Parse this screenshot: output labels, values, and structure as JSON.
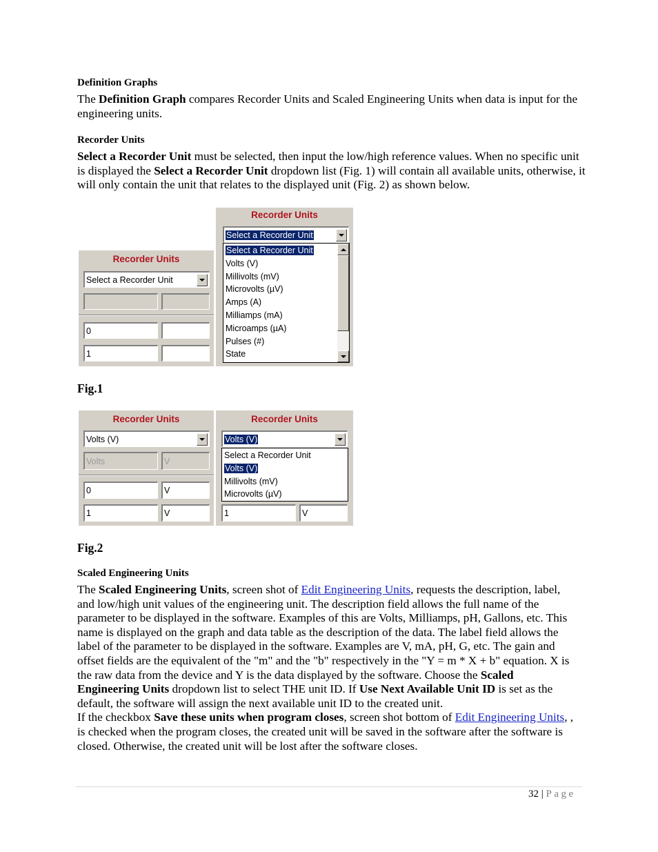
{
  "sections": {
    "definition_graphs": {
      "heading": "Definition Graphs",
      "para_intro": "The ",
      "para_bold": "Definition Graph",
      "para_rest": " compares Recorder Units and Scaled Engineering Units when data is input for the engineering units."
    },
    "recorder_units": {
      "heading": "Recorder Units",
      "p1_bold": "Select a Recorder Unit",
      "p1_text": " must be selected, then input the low/high reference values. When no specific unit is displayed the ",
      "p1_bold2": "Select a Recorder Unit",
      "p1_text2": " dropdown list (Fig. 1) will contain all available units, otherwise, it will only contain the unit that relates to the displayed unit (Fig. 2) as shown below."
    },
    "scaled_units": {
      "heading": "Scaled Engineering Units",
      "t1": "The ",
      "b1": "Scaled Engineering Units",
      "t2": ", screen shot of ",
      "link1": "Edit Engineering Units",
      "t3": ", requests the description, label, and low/high unit values of the engineering unit. The description field allows the full name of the parameter to be displayed in the software. Examples of this are Volts, Milliamps, pH, Gallons, etc. This name is displayed on the graph and data table as the description of the data. The label field allows the label of the parameter to be displayed in the software. Examples are V, mA, pH, G, etc. The gain and offset fields are the equivalent of the \"m\" and the \"b\" respectively in the \"Y = m * X + b\" equation. X is the raw data from the device and Y is the data displayed by the software. Choose the ",
      "b2": "Scaled Engineering Units",
      "t4": " dropdown list to select THE unit ID. If ",
      "b3": "Use Next Available Unit ID",
      "t5": " is set as the default, the software will assign the next available unit ID to the created unit.",
      "t6": "If the checkbox ",
      "b4": "Save these units when program closes",
      "t7": ", screen shot bottom of ",
      "link2": "Edit Engineering Units",
      "t8": ", , is checked when the program closes, the created unit will be saved in the software after the software is closed. Otherwise, the created unit will be lost after the software closes."
    }
  },
  "fig1": {
    "label": "Fig.1",
    "left_panel": {
      "title": "Recorder Units",
      "combo_value": "Select a Recorder Unit",
      "desc_value": "",
      "label_value": "",
      "low_value": "0",
      "low_unit": "",
      "high_value": "1",
      "high_unit": ""
    },
    "right_panel": {
      "title": "Recorder Units",
      "combo_value": "Select a Recorder Unit",
      "options": [
        "Select a Recorder Unit",
        "Volts (V)",
        "Millivolts (mV)",
        "Microvolts (µV)",
        "Amps (A)",
        "Milliamps (mA)",
        "Microamps (µA)",
        "Pulses (#)",
        "State"
      ],
      "selected_index": 0
    }
  },
  "fig2": {
    "label": "Fig.2",
    "left_panel": {
      "title": "Recorder Units",
      "combo_value": "Volts (V)",
      "desc_value": "Volts",
      "label_value": "V",
      "low_value": "0",
      "low_unit": "V",
      "high_value": "1",
      "high_unit": "V"
    },
    "right_panel": {
      "title": "Recorder Units",
      "combo_value": "Volts (V)",
      "options": [
        "Select a Recorder Unit",
        "Volts (V)",
        "Millivolts (mV)",
        "Microvolts (µV)"
      ],
      "selected_index": 1,
      "high_value": "1",
      "high_unit": "V"
    }
  },
  "footer": {
    "page_number": "32",
    "separator": " | ",
    "page_word": "Page"
  }
}
